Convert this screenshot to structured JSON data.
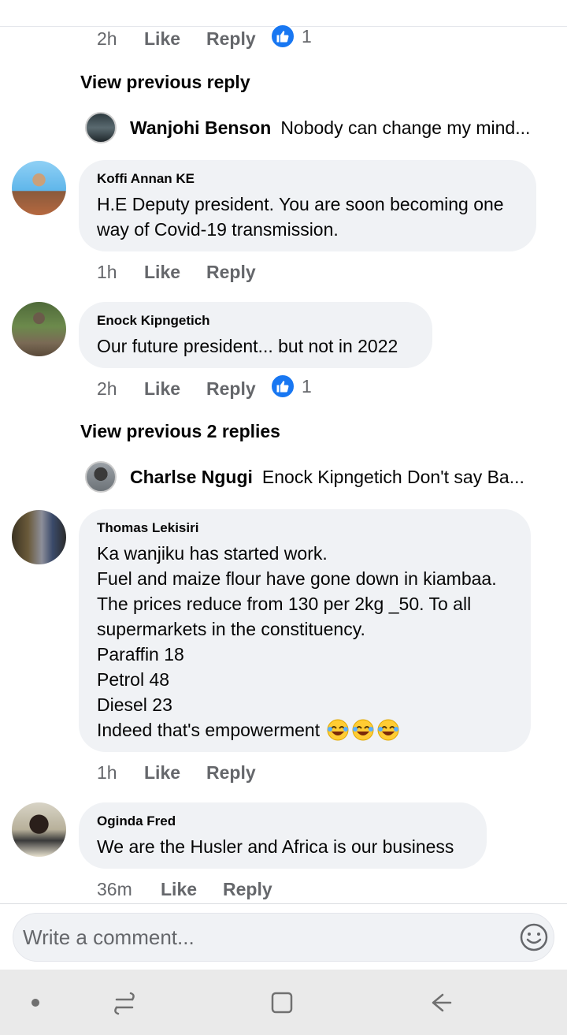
{
  "actions": {
    "like": "Like",
    "reply": "Reply"
  },
  "top": {
    "time": "2h",
    "reactions": "1"
  },
  "view_previous_1": "View previous reply",
  "collapsed_1": {
    "name": "Wanjohi Benson",
    "text": "Nobody can change my mind..."
  },
  "comments": [
    {
      "author": "Koffi Annan KE",
      "lines": [
        "H.E Deputy president. You are soon becoming one",
        "way of Covid-19 transmission."
      ],
      "time": "1h",
      "reactions": ""
    },
    {
      "author": "Enock Kipngetich",
      "lines": [
        "Our future president... but not in 2022"
      ],
      "time": "2h",
      "reactions": "1"
    },
    {
      "author": "Thomas Lekisiri",
      "lines": [
        "Ka wanjiku has started work.",
        "Fuel and maize flour have gone down in kiambaa.",
        "The prices reduce from 130 per 2kg _50. To all",
        "supermarkets in the constituency.",
        "Paraffin 18",
        "Petrol 48",
        "Diesel 23",
        "Indeed that's empowerment"
      ],
      "time": "1h",
      "reactions": ""
    },
    {
      "author": "Oginda Fred",
      "lines": [
        "We are the Husler and Africa is our business"
      ],
      "time": "36m",
      "reactions": ""
    }
  ],
  "view_previous_2": "View previous 2 replies",
  "collapsed_2": {
    "name": "Charlse Ngugi",
    "text": "Enock Kipngetich Don't say Ba..."
  },
  "composer": {
    "placeholder": "Write a comment..."
  },
  "colors": {
    "accent": "#1877f2",
    "bubble": "#f0f2f5",
    "meta": "#65676b"
  },
  "icons": [
    "like-reaction-icon",
    "emoji-icon",
    "nav-dot-icon",
    "recent-apps-icon",
    "home-icon",
    "back-icon"
  ]
}
